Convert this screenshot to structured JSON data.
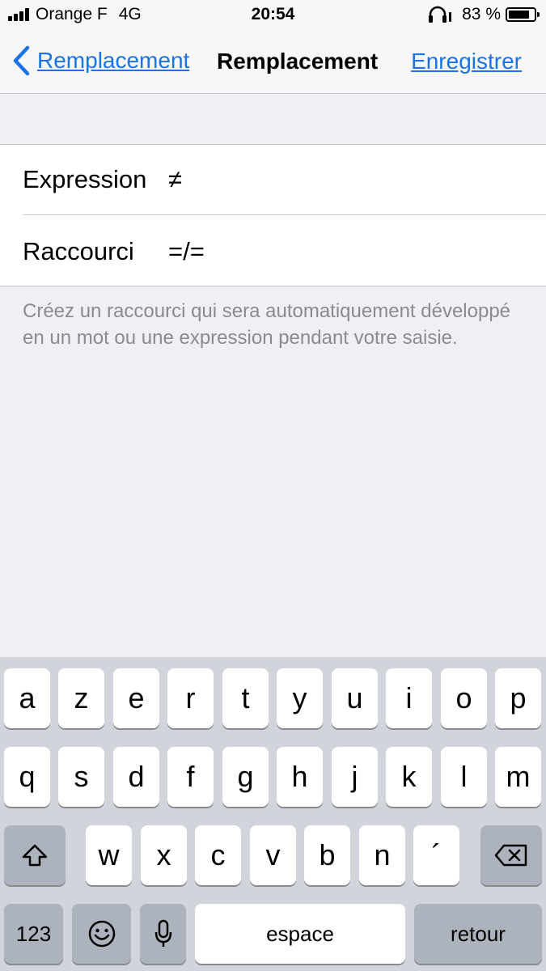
{
  "status": {
    "carrier": "Orange F",
    "network": "4G",
    "time": "20:54",
    "battery": "83 %",
    "battery_level": 0.83
  },
  "nav": {
    "back_label": "Remplacement",
    "title": "Remplacement",
    "save_label": "Enregistrer"
  },
  "form": {
    "expression_label": "Expression",
    "expression_value": "≠",
    "shortcut_label": "Raccourci",
    "shortcut_value": "=/="
  },
  "footer": "Créez un raccourci qui sera automatiquement développé en un mot ou une expression pendant votre saisie.",
  "keyboard": {
    "row1": [
      "a",
      "z",
      "e",
      "r",
      "t",
      "y",
      "u",
      "i",
      "o",
      "p"
    ],
    "row2": [
      "q",
      "s",
      "d",
      "f",
      "g",
      "h",
      "j",
      "k",
      "l",
      "m"
    ],
    "row3": [
      "w",
      "x",
      "c",
      "v",
      "b",
      "n",
      "´"
    ],
    "numbers": "123",
    "space": "espace",
    "return": "retour"
  },
  "colors": {
    "link": "#1a73e8",
    "background": "#efeff4",
    "keyboard_bg": "#d1d5db"
  }
}
